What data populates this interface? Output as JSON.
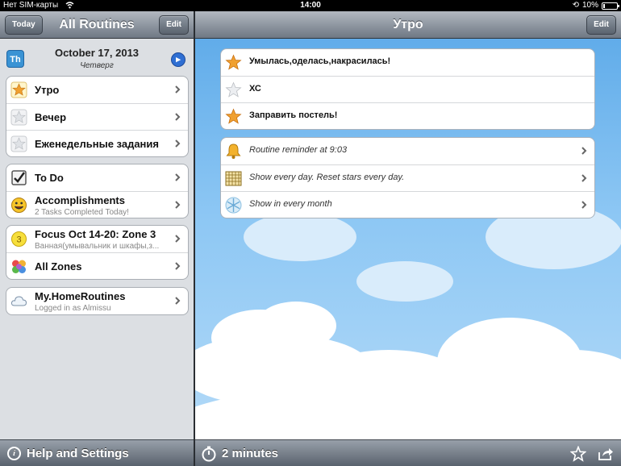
{
  "status": {
    "carrier": "Нет SIM-карты",
    "time": "14:00",
    "battery": "10%",
    "battery_level": 0.1
  },
  "left": {
    "title": "All Routines",
    "today_label": "Today",
    "edit_label": "Edit",
    "date": "October 17, 2013",
    "weekday": "Четверг",
    "app_icon_text": "Th",
    "routines": [
      {
        "label": "Утро"
      },
      {
        "label": "Вечер"
      },
      {
        "label": "Еженедельные задания"
      }
    ],
    "todo": {
      "label": "To Do"
    },
    "accomplishments": {
      "label": "Accomplishments",
      "sub": "2 Tasks Completed Today!"
    },
    "focus": {
      "label": "Focus Oct 14-20: Zone 3",
      "sub": "Ванная(умывальник и шкафы,з...",
      "badge": "3"
    },
    "zones": {
      "label": "All Zones"
    },
    "account": {
      "label": "My.HomeRoutines",
      "sub": "Logged in as Almissu"
    },
    "help_label": "Help and Settings"
  },
  "right": {
    "title": "Утро",
    "edit_label": "Edit",
    "tasks": [
      {
        "label": "Умылась,оделась,накрасилась!",
        "starred": true
      },
      {
        "label": "ХС",
        "starred": false
      },
      {
        "label": "Заправить постель!",
        "starred": true
      }
    ],
    "settings": [
      {
        "label": "Routine reminder at 9:03",
        "icon": "bell-icon"
      },
      {
        "label": "Show every day. Reset stars every day.",
        "icon": "calendar-icon"
      },
      {
        "label": "Show in every month",
        "icon": "snowflake-icon"
      }
    ],
    "timer_label": "2 minutes"
  },
  "colors": {
    "star_on": "#f0a030",
    "star_off": "#d9dde2",
    "accent_blue": "#2f6fd3"
  }
}
